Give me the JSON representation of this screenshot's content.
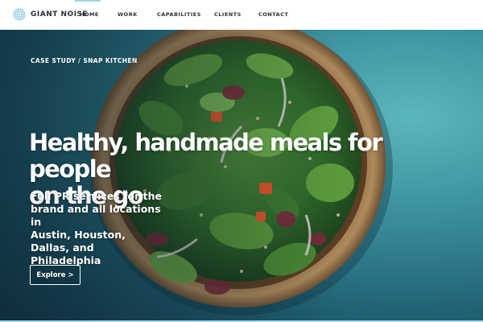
{
  "brand": {
    "name": "GIANT NOISE",
    "logo_icon": "fingerprint-spiral-icon",
    "accent": "#9fd3e4"
  },
  "nav": {
    "items": [
      {
        "label": "HOME",
        "active": true
      },
      {
        "label": "WORK"
      },
      {
        "label": "CAPABILITIES"
      },
      {
        "label": "CLIENTS"
      },
      {
        "label": "CONTACT"
      }
    ]
  },
  "hero": {
    "eyebrow": "CASE STUDY / SNAP KITCHEN",
    "headline_line1": "Healthy, handmade meals for people",
    "headline_line2": "on the go",
    "subhead_line1": "Full PR services for the",
    "subhead_line2": "brand and all locations in",
    "subhead_line3": "Austin, Houston, Dallas, and",
    "subhead_line4": "Philadelphia",
    "cta_label": "Explore >",
    "background": "salad bowl photo on teal surface"
  }
}
